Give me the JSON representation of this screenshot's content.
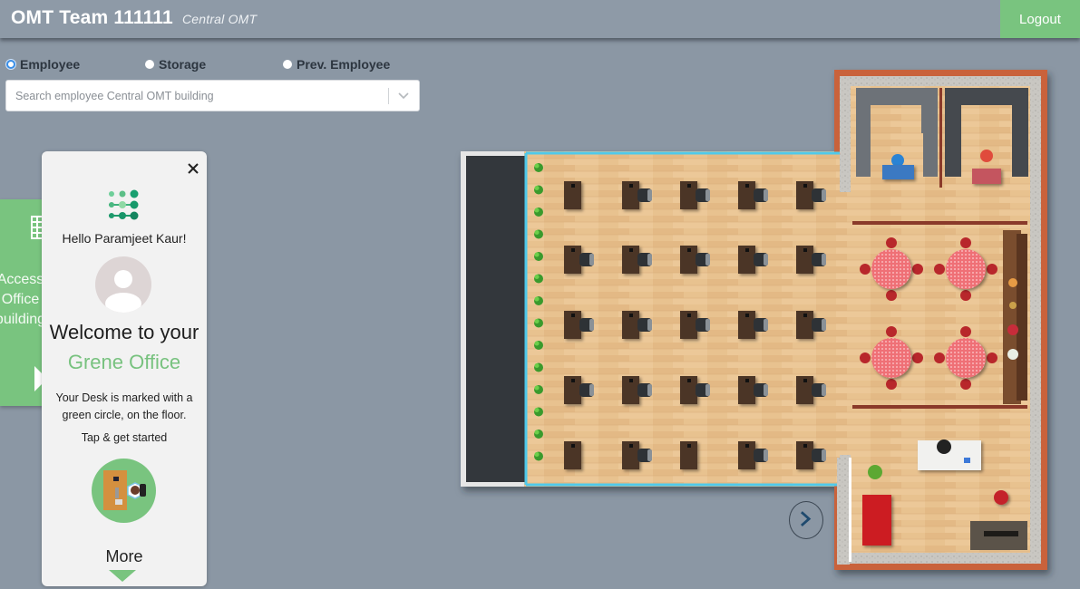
{
  "header": {
    "team_title": "OMT Team 111111",
    "subtitle": "Central OMT",
    "logout_label": "Logout"
  },
  "search_mode": {
    "options": [
      {
        "label": "Employee",
        "checked": true
      },
      {
        "label": "Storage",
        "checked": false
      },
      {
        "label": "Prev. Employee",
        "checked": false
      }
    ]
  },
  "search": {
    "placeholder": "Search employee Central OMT building",
    "value": ""
  },
  "access_tab": {
    "label": "Access Office building",
    "icon": "building-icon"
  },
  "welcome_panel": {
    "greeting": "Hello Paramjeet Kaur!",
    "welcome_line": "Welcome to your",
    "office_name": "Grene Office",
    "desk_hint": "Your Desk is marked with a green circle, on the floor.",
    "cta": "Tap & get started",
    "more_label": "More",
    "icons": [
      "close-icon",
      "brand-logo-icon",
      "avatar-icon",
      "desk-icon",
      "triangle-down-icon"
    ],
    "accent_color": "#79c47f"
  },
  "floor_plan": {
    "desk_rows": [
      [
        false,
        true,
        true,
        true,
        true
      ],
      [
        true,
        true,
        true,
        true,
        true
      ],
      [
        true,
        true,
        true,
        true,
        true
      ],
      [
        true,
        true,
        true,
        true,
        true
      ],
      [
        false,
        true,
        false,
        true,
        true
      ]
    ],
    "plant_count": 14,
    "cafeteria_tables": 4,
    "rooms": [
      "office-room-blue",
      "office-room-red",
      "cafeteria",
      "reception",
      "lounge"
    ],
    "next_button_icon": "chevron-right-icon"
  },
  "colors": {
    "background": "#8b97a4",
    "accent_green": "#79c47f",
    "radio_checked": "#3a8ee6",
    "wood_floor": "#e6bd8a",
    "brick_wall": "#c9623a"
  }
}
